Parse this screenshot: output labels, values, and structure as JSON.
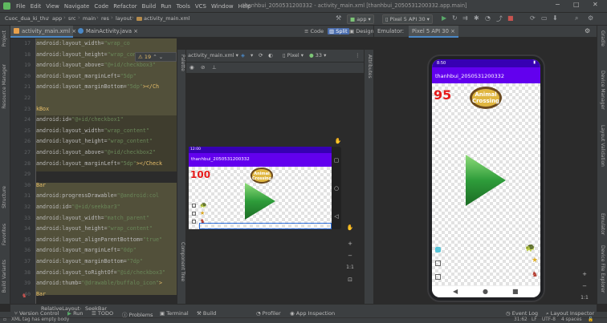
{
  "menu": {
    "items": [
      "File",
      "Edit",
      "View",
      "Navigate",
      "Code",
      "Refactor",
      "Build",
      "Run",
      "Tools",
      "VCS",
      "Window",
      "Help"
    ],
    "window_title": "thanhbui_2050531200332 - activity_main.xml [thanhbui_2050531200332.app.main]"
  },
  "window_controls": {
    "minimize": "−",
    "maximize": "□",
    "close": "✕"
  },
  "breadcrumb": [
    "Cuoc_dua_ki_thu",
    "app",
    "src",
    "main",
    "res",
    "layout",
    "activity_main.xml"
  ],
  "run_config": {
    "module": "app",
    "device": "Pixel 5 API 30"
  },
  "editor_tabs": [
    {
      "label": "activity_main.xml",
      "active": true
    },
    {
      "label": "MainActivity.java",
      "active": false
    }
  ],
  "view_modes": {
    "code": "Code",
    "split": "Split",
    "design": "Design"
  },
  "inspection_badge": "⚠ 19",
  "line_numbers": [
    "17",
    "18",
    "19",
    "20",
    "21",
    "22",
    "23",
    "24",
    "25",
    "26",
    "27",
    "28",
    "29",
    "30",
    "31",
    "32",
    "33",
    "34",
    "35",
    "36",
    "37",
    "38",
    "39",
    "40"
  ],
  "code_lines": [
    {
      "text": "android:layout_width=\"wrap_co",
      "attr": "android:layout_width=",
      "val": "\"wrap_co"
    },
    {
      "attr": "android:layout_height=",
      "val": "\"wrap_content\""
    },
    {
      "attr": "android:layout_above=",
      "val": "\"@+id/checkbox3\""
    },
    {
      "attr": "android:layout_marginLeft=",
      "val": "\"5dp\""
    },
    {
      "attr": "android:layout_marginBottom=",
      "val": "\"5dp\"",
      "tail": "></Ch"
    },
    {
      "attr": "",
      "val": ""
    },
    {
      "attr": "",
      "val": "",
      "tag": "kBox"
    },
    {
      "attr": "android:id=",
      "val": "\"@+id/checkbox1\""
    },
    {
      "attr": "android:layout_width=",
      "val": "\"wrap_content\""
    },
    {
      "attr": "android:layout_height=",
      "val": "\"wrap_content\""
    },
    {
      "attr": "android:layout_above=",
      "val": "\"@+id/checkbox2\""
    },
    {
      "attr": "android:layout_marginLeft=",
      "val": "\"5dp\"",
      "tail": "></Check"
    },
    {
      "attr": "",
      "val": ""
    },
    {
      "attr": "",
      "val": "",
      "tag": "Bar"
    },
    {
      "attr": "android:progressDrawable=",
      "val": "\"@android:col"
    },
    {
      "attr": "android:id=",
      "val": "\"@+id/seekbar3\""
    },
    {
      "attr": "android:layout_width=",
      "val": "\"match_parent\""
    },
    {
      "attr": "android:layout_height=",
      "val": "\"wrap_content\""
    },
    {
      "attr": "android:layout_alignParentBottom=",
      "val": "\"true\""
    },
    {
      "attr": "android:layout_marginLeft=",
      "val": "\"0dp\""
    },
    {
      "attr": "android:layout_marginBottom=",
      "val": "\"7dp\""
    },
    {
      "attr": "android:layout_toRightOf=",
      "val": "\"@id/checkbox3\""
    },
    {
      "attr": "android:thumb=",
      "val": "\"@drawable/buffalo_icon\"",
      "tail": ">"
    },
    {
      "attr": "",
      "val": "",
      "tag": "Bar"
    }
  ],
  "design": {
    "file_selector": "activity_main.xml",
    "device_selector": "Pixel",
    "api_selector": "33",
    "palette_label": "Palette",
    "component_tree_label": "Component Tree",
    "attributes_label": "Attributes"
  },
  "preview": {
    "status_time": "12:00",
    "app_title": "thanhbui_2050531200332",
    "score": "100"
  },
  "emulator": {
    "label": "Emulator:",
    "device_tab": "Pixel 5 API 30",
    "status_time": "8:50",
    "app_title": "thanhbui_2050531200332",
    "score": "95"
  },
  "logo_text": "Animal Crossing",
  "left_tools": [
    "Project",
    "Resource Manager",
    "Structure",
    "Favorites",
    "Build Variants"
  ],
  "right_tools": [
    "Gradle",
    "Device Manager",
    "Layout Validation",
    "Emulator",
    "Device File Explorer"
  ],
  "bottom_breadcrumbs": [
    "RelativeLayout",
    "SeekBar"
  ],
  "tool_windows": [
    "Version Control",
    "Run",
    "TODO",
    "Problems",
    "Terminal",
    "Build",
    "Profiler",
    "App Inspection"
  ],
  "tool_windows_right": [
    "Event Log",
    "Layout Inspector"
  ],
  "status": {
    "message": "XML tag has empty body",
    "position": "31:62",
    "line_sep": "LF",
    "encoding": "UTF-8",
    "indent": "4 spaces"
  },
  "colors": {
    "app_bar": "#6200ee",
    "status_bar": "#3700b3",
    "score": "#e51b1b",
    "play_green": "#2e9c3a",
    "accent": "#4a88c7"
  }
}
